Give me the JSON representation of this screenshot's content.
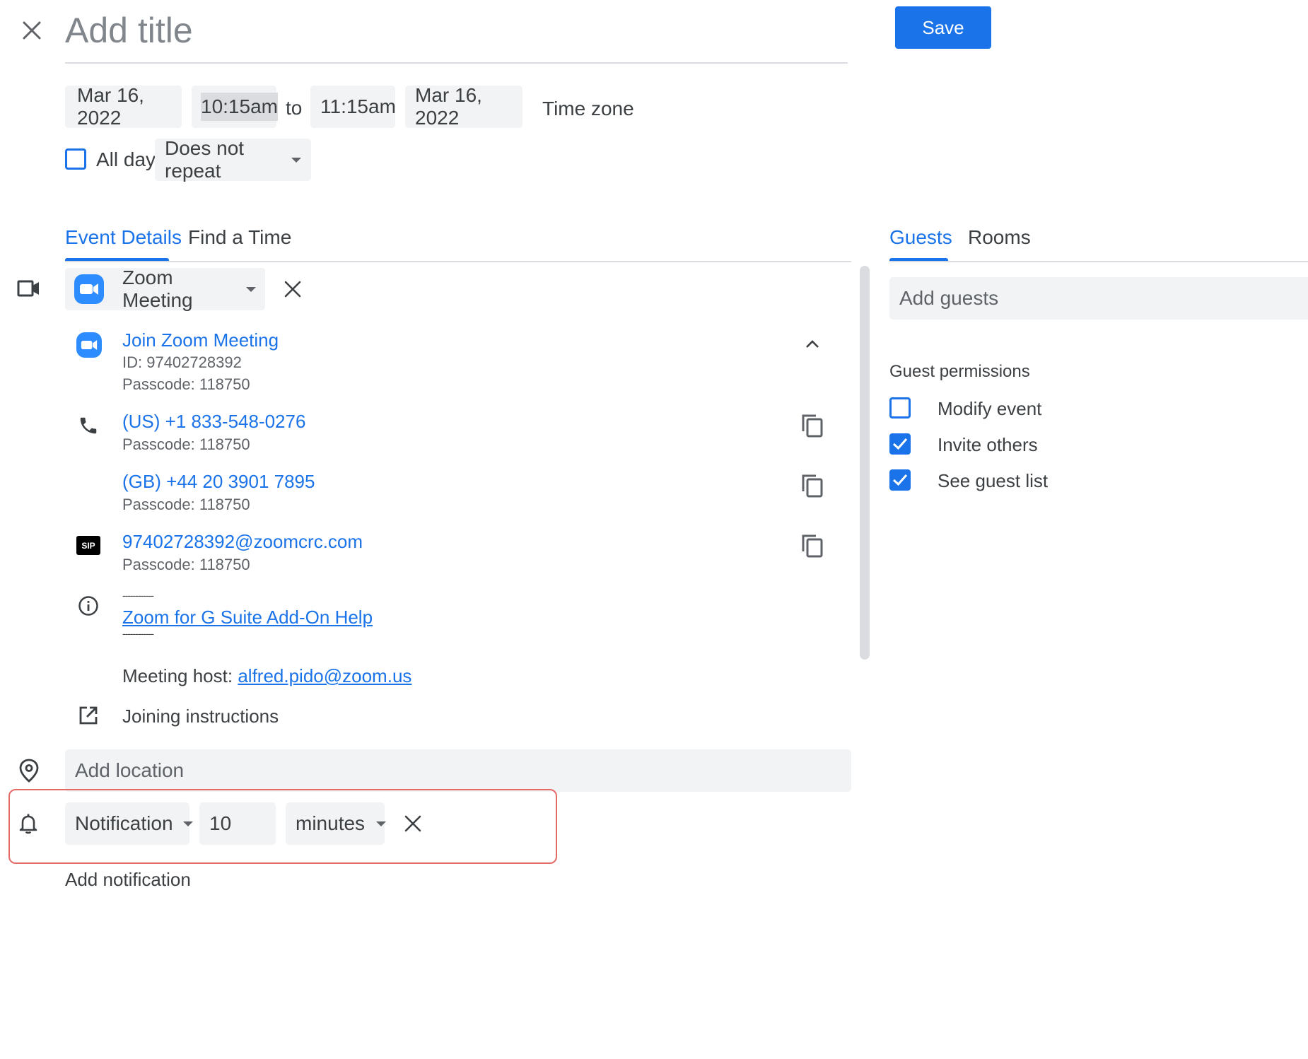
{
  "header": {
    "title_placeholder": "Add title",
    "save_label": "Save"
  },
  "datetime": {
    "start_date": "Mar 16, 2022",
    "start_time": "10:15am",
    "to_label": "to",
    "end_time": "11:15am",
    "end_date": "Mar 16, 2022",
    "timezone_label": "Time zone",
    "allday_label": "All day",
    "repeat_value": "Does not repeat"
  },
  "tabs": {
    "left": [
      "Event Details",
      "Find a Time"
    ],
    "right": [
      "Guests",
      "Rooms"
    ]
  },
  "conference": {
    "select_label": "Zoom Meeting",
    "join_label": "Join Zoom Meeting",
    "id_text": "ID: 97402728392",
    "passcode_text": "Passcode: 118750",
    "phone_us": "(US) +1 833-548-0276",
    "phone_gb": "(GB) +44 20 3901 7895",
    "sip_address": "97402728392@zoomcrc.com",
    "sip_badge": "SIP",
    "dashes": "------------",
    "help_link": "Zoom for G Suite Add-On Help",
    "host_label": "Meeting host:",
    "host_email": "alfred.pido@zoom.us",
    "joining_instructions": "Joining instructions"
  },
  "location": {
    "placeholder": "Add location"
  },
  "notification": {
    "type": "Notification",
    "amount": "10",
    "unit": "minutes",
    "add_label": "Add notification"
  },
  "guests": {
    "placeholder": "Add guests",
    "permissions_title": "Guest permissions",
    "permissions": [
      {
        "label": "Modify event",
        "checked": false
      },
      {
        "label": "Invite others",
        "checked": true
      },
      {
        "label": "See guest list",
        "checked": true
      }
    ]
  },
  "colors": {
    "accent": "#1a73e8",
    "field_bg": "#f1f3f4",
    "highlight_border": "#e46a66",
    "zoom_blue": "#2d8cff"
  }
}
